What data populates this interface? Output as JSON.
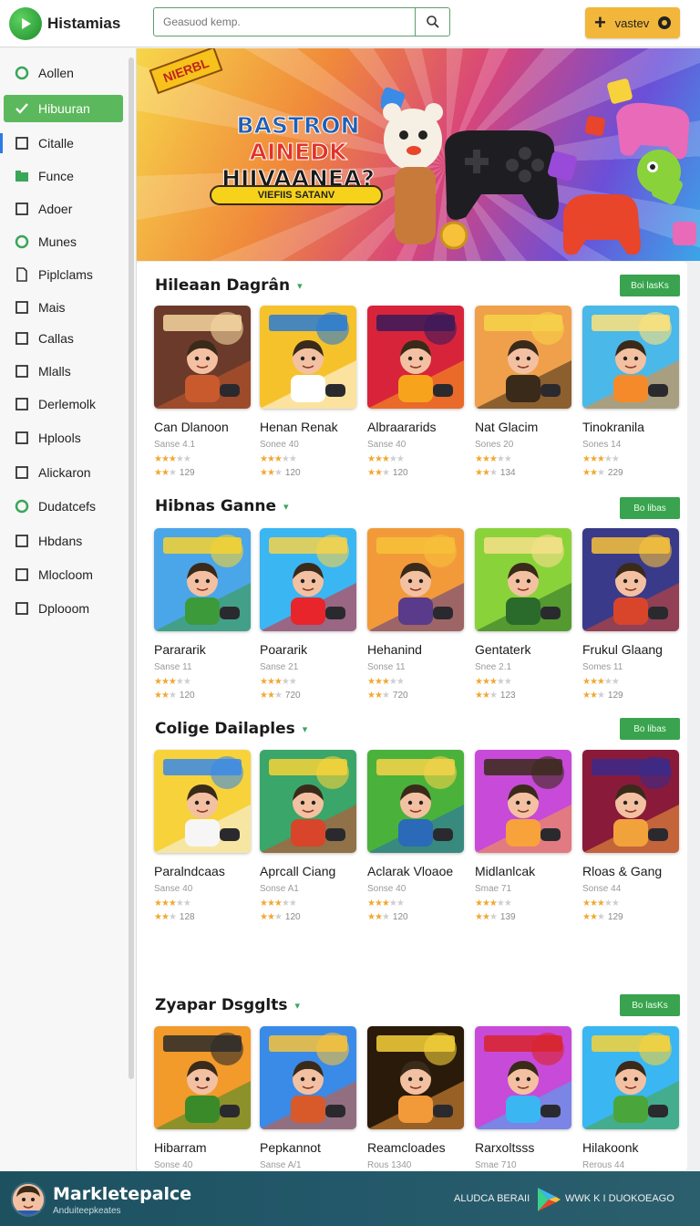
{
  "header": {
    "logo_text": "Histamias",
    "search_placeholder": "Geasuod kemp.",
    "action_button": "vastev"
  },
  "sidebar": {
    "items": [
      {
        "label": "Aollen",
        "icon": "circle-icon"
      },
      {
        "label": "Hibuuran",
        "icon": "check-icon",
        "active": true
      },
      {
        "label": "Citalle",
        "icon": "square-icon"
      },
      {
        "label": "Funce",
        "icon": "folder-icon"
      },
      {
        "label": "Adoer",
        "icon": "square-icon"
      },
      {
        "label": "Munes",
        "icon": "circle-icon"
      },
      {
        "label": "Piplclams",
        "icon": "document-icon"
      },
      {
        "label": "Mais",
        "icon": "square-icon"
      },
      {
        "label": "Callas",
        "icon": "square-icon"
      },
      {
        "label": "Mlalls",
        "icon": "square-icon"
      },
      {
        "label": "Derlemolk",
        "icon": "square-icon"
      },
      {
        "label": "Hplools",
        "icon": "square-icon"
      },
      {
        "label": "Alickaron",
        "icon": "square-icon"
      },
      {
        "label": "Dudatcefs",
        "icon": "circle-icon"
      },
      {
        "label": "Hbdans",
        "icon": "square-icon"
      },
      {
        "label": "Mlocloom",
        "icon": "square-icon"
      },
      {
        "label": "Dplooom",
        "icon": "square-icon"
      }
    ]
  },
  "banner": {
    "ribbon": "NIERBL",
    "title_lines": [
      "BASTRON",
      "AINEDK",
      "HIIVAANEA?"
    ],
    "subtitle": "VIEFIIS SATANV"
  },
  "sections": [
    {
      "title": "Hileaan Dagrân",
      "button": "Boi lasKs",
      "cards": [
        {
          "name": "Can Dlanoon",
          "sub": "Sanse 4.1",
          "stars": 3,
          "count": "129",
          "colors": [
            "#6b3a2a",
            "#c85a2d",
            "#f4d6a0"
          ]
        },
        {
          "name": "Henan Renak",
          "sub": "Sonee 40",
          "stars": 3,
          "count": "120",
          "colors": [
            "#f6c22b",
            "#ffffff",
            "#2a7bd4"
          ]
        },
        {
          "name": "Albraararids",
          "sub": "Sanse 40",
          "stars": 3,
          "count": "120",
          "colors": [
            "#d8243a",
            "#f7a41c",
            "#3a1a5a"
          ]
        },
        {
          "name": "Nat Glacim",
          "sub": "Sones 20",
          "stars": 3,
          "count": "134",
          "colors": [
            "#f0a04a",
            "#3a2a1a",
            "#f6d24a"
          ]
        },
        {
          "name": "Tinokranila",
          "sub": "Sones 14",
          "stars": 3,
          "count": "229",
          "colors": [
            "#4ab8e8",
            "#f58a2a",
            "#ffe27a"
          ]
        }
      ]
    },
    {
      "title": "Hibnas Ganne",
      "button": "Bo libas",
      "cards": [
        {
          "name": "Parararik",
          "sub": "Sanse 11",
          "stars": 3,
          "count": "120",
          "colors": [
            "#4aa6e8",
            "#3d9a3a",
            "#f7d230"
          ]
        },
        {
          "name": "Poararik",
          "sub": "Sanse 21",
          "stars": 3,
          "count": "720",
          "colors": [
            "#3ab6f2",
            "#e8252a",
            "#f6d24a"
          ]
        },
        {
          "name": "Hehanind",
          "sub": "Sonse 11",
          "stars": 3,
          "count": "720",
          "colors": [
            "#f29a3a",
            "#5a3a8a",
            "#f7c23a"
          ]
        },
        {
          "name": "Gentaterk",
          "sub": "Snee 2.1",
          "stars": 3,
          "count": "123",
          "colors": [
            "#8ad23a",
            "#2a6a2a",
            "#f6e08a"
          ]
        },
        {
          "name": "Frukul Glaang",
          "sub": "Somes 11",
          "stars": 3,
          "count": "129",
          "colors": [
            "#3a3a8a",
            "#d8452a",
            "#f7c23a"
          ]
        }
      ]
    },
    {
      "title": "Colige Dailaples",
      "button": "Bo libas",
      "cards": [
        {
          "name": "Paralndcaas",
          "sub": "Sanse 40",
          "stars": 3,
          "count": "128",
          "colors": [
            "#f7d23a",
            "#f6f6f6",
            "#3a8ae8"
          ]
        },
        {
          "name": "Aprcall Ciang",
          "sub": "Sonse A1",
          "stars": 3,
          "count": "120",
          "colors": [
            "#3aa66a",
            "#d8452a",
            "#f7d23a"
          ]
        },
        {
          "name": "Aclarak Vloaoe",
          "sub": "Sonse 40",
          "stars": 3,
          "count": "120",
          "colors": [
            "#4ab23a",
            "#2a6ab8",
            "#f6d24a"
          ]
        },
        {
          "name": "Midlanlcak",
          "sub": "Smae 71",
          "stars": 3,
          "count": "139",
          "colors": [
            "#c84ad8",
            "#f7a23a",
            "#3a2a1a"
          ]
        },
        {
          "name": "Rloas & Gang",
          "sub": "Sonse 44",
          "stars": 3,
          "count": "129",
          "colors": [
            "#8a1a3a",
            "#f2a23a",
            "#3a2a8a"
          ]
        }
      ]
    },
    {
      "title": "Zyapar Dsgglts",
      "button": "Bo lasKs",
      "cards": [
        {
          "name": "Hibarram",
          "sub": "Sonse 40",
          "stars": 0,
          "count": "",
          "colors": [
            "#f29a2a",
            "#3a8a2a",
            "#2a2a2a"
          ]
        },
        {
          "name": "Pepkannot",
          "sub": "Sanse A/1",
          "stars": 0,
          "count": "",
          "colors": [
            "#3a8ae8",
            "#d85a2a",
            "#f7c23a"
          ]
        },
        {
          "name": "Reamcloades",
          "sub": "Rous 1340",
          "stars": 0,
          "count": "",
          "colors": [
            "#2a1a0a",
            "#f29a3a",
            "#f7d23a"
          ]
        },
        {
          "name": "Rarxoltsss",
          "sub": "Smae 710",
          "stars": 0,
          "count": "",
          "colors": [
            "#c84ad8",
            "#3ab6f2",
            "#d8252a"
          ]
        },
        {
          "name": "Hilakoonk",
          "sub": "Rerous 44",
          "stars": 0,
          "count": "",
          "colors": [
            "#3ab6f2",
            "#4aa63a",
            "#f7d23a"
          ]
        }
      ]
    }
  ],
  "footer": {
    "title": "Markletepalce",
    "subtitle": "Anduiteepkeates",
    "link1": "ALUDCA BERAII",
    "link2": "WWK K I   DUOKOEAGO"
  }
}
